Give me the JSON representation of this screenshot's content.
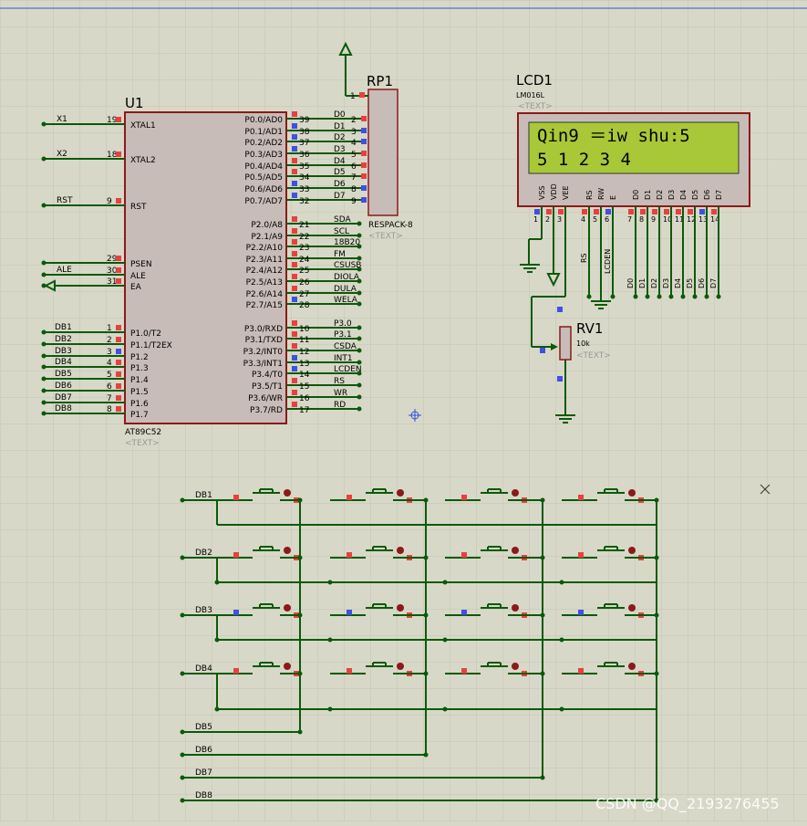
{
  "mcu": {
    "ref": "U1",
    "part": "AT89C52",
    "text_tag": "<TEXT>",
    "left_pins": [
      {
        "net": "X1",
        "num": "19",
        "name": "XTAL1"
      },
      {
        "net": "X2",
        "num": "18",
        "name": "XTAL2"
      },
      {
        "net": "RST",
        "num": "9",
        "name": "RST"
      },
      {
        "net": "",
        "num": "29",
        "name": "PSEN"
      },
      {
        "net": "ALE",
        "num": "30",
        "name": "ALE"
      },
      {
        "net": "",
        "num": "31",
        "name": "EA"
      },
      {
        "net": "DB1",
        "num": "1",
        "name": "P1.0/T2"
      },
      {
        "net": "DB2",
        "num": "2",
        "name": "P1.1/T2EX"
      },
      {
        "net": "DB3",
        "num": "3",
        "name": "P1.2"
      },
      {
        "net": "DB4",
        "num": "4",
        "name": "P1.3"
      },
      {
        "net": "DB5",
        "num": "5",
        "name": "P1.4"
      },
      {
        "net": "DB6",
        "num": "6",
        "name": "P1.5"
      },
      {
        "net": "DB7",
        "num": "7",
        "name": "P1.6"
      },
      {
        "net": "DB8",
        "num": "8",
        "name": "P1.7"
      }
    ],
    "right_pins": [
      {
        "name": "P0.0/AD0",
        "num": "39",
        "net": "D0"
      },
      {
        "name": "P0.1/AD1",
        "num": "38",
        "net": "D1"
      },
      {
        "name": "P0.2/AD2",
        "num": "37",
        "net": "D2"
      },
      {
        "name": "P0.3/AD3",
        "num": "36",
        "net": "D3"
      },
      {
        "name": "P0.4/AD4",
        "num": "35",
        "net": "D4"
      },
      {
        "name": "P0.5/AD5",
        "num": "34",
        "net": "D5"
      },
      {
        "name": "P0.6/AD6",
        "num": "33",
        "net": "D6"
      },
      {
        "name": "P0.7/AD7",
        "num": "32",
        "net": "D7"
      },
      {
        "name": "P2.0/A8",
        "num": "21",
        "net": "SDA"
      },
      {
        "name": "P2.1/A9",
        "num": "22",
        "net": "SCL"
      },
      {
        "name": "P2.2/A10",
        "num": "23",
        "net": "18B20"
      },
      {
        "name": "P2.3/A11",
        "num": "24",
        "net": "FM"
      },
      {
        "name": "P2.4/A12",
        "num": "25",
        "net": "CSUSB"
      },
      {
        "name": "P2.5/A13",
        "num": "26",
        "net": "DIOLA"
      },
      {
        "name": "P2.6/A14",
        "num": "27",
        "net": "DULA"
      },
      {
        "name": "P2.7/A15",
        "num": "28",
        "net": "WELA"
      },
      {
        "name": "P3.0/RXD",
        "num": "10",
        "net": "P3.0"
      },
      {
        "name": "P3.1/TXD",
        "num": "11",
        "net": "P3.1"
      },
      {
        "name": "P3.2/INT0",
        "num": "12",
        "net": "CSDA"
      },
      {
        "name": "P3.3/INT1",
        "num": "13",
        "net": "INT1"
      },
      {
        "name": "P3.4/T0",
        "num": "14",
        "net": "LCDEN"
      },
      {
        "name": "P3.5/T1",
        "num": "15",
        "net": "RS"
      },
      {
        "name": "P3.6/WR",
        "num": "16",
        "net": "WR"
      },
      {
        "name": "P3.7/RD",
        "num": "17",
        "net": "RD"
      }
    ]
  },
  "rp1": {
    "ref": "RP1",
    "part": "RESPACK-8",
    "text_tag": "<TEXT>",
    "pin1": "1",
    "pins": [
      "2",
      "3",
      "4",
      "5",
      "6",
      "7",
      "8",
      "9"
    ]
  },
  "lcd": {
    "ref": "LCD1",
    "part": "LM016L",
    "text_tag": "<TEXT>",
    "line1": "Qin9 ＝iw shu:5",
    "line2": "5 1 2 3 4",
    "pin_names": [
      "VSS",
      "VDD",
      "VEE",
      "RS",
      "RW",
      "E",
      "D0",
      "D1",
      "D2",
      "D3",
      "D4",
      "D5",
      "D6",
      "D7"
    ],
    "pin_nums": [
      "1",
      "2",
      "3",
      "4",
      "5",
      "6",
      "7",
      "8",
      "9",
      "10",
      "11",
      "12",
      "13",
      "14"
    ],
    "bus_labels": [
      "RS",
      "LCDEN",
      "D0",
      "D1",
      "D2",
      "D3",
      "D4",
      "D5",
      "D6",
      "D7"
    ]
  },
  "rv1": {
    "ref": "RV1",
    "value": "10k",
    "text_tag": "<TEXT>"
  },
  "keypad": {
    "row_labels": [
      "DB1",
      "DB2",
      "DB3",
      "DB4"
    ],
    "col_labels": [
      "DB5",
      "DB6",
      "DB7",
      "DB8"
    ]
  },
  "watermark": "CSDN @QQ_2193276455",
  "colors": {
    "wire": "#0a5a0a",
    "body_fill": "#c8bcb8",
    "body_stroke": "#8b1a1a",
    "lcd_screen": "#a8c838",
    "pin_red": "#e84040",
    "pin_blue": "#4050e0"
  }
}
